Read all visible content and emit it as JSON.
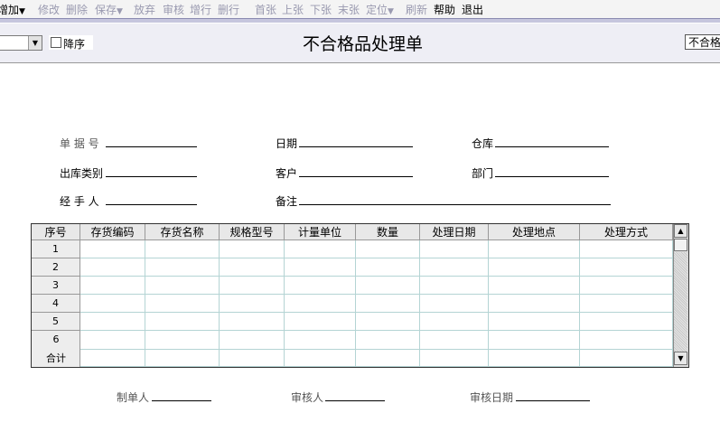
{
  "toolbar": {
    "items": [
      {
        "label": "增加",
        "enabled": true,
        "dropdown": true
      },
      {
        "label": "修改",
        "enabled": false
      },
      {
        "label": "删除",
        "enabled": false
      },
      {
        "label": "保存",
        "enabled": false,
        "dropdown": true
      },
      {
        "label": "放弃",
        "enabled": false
      },
      {
        "label": "审核",
        "enabled": false
      },
      {
        "label": "增行",
        "enabled": false
      },
      {
        "label": "删行",
        "enabled": false
      },
      {
        "label": "首张",
        "enabled": false
      },
      {
        "label": "上张",
        "enabled": false
      },
      {
        "label": "下张",
        "enabled": false
      },
      {
        "label": "末张",
        "enabled": false
      },
      {
        "label": "定位",
        "enabled": false,
        "dropdown": true
      },
      {
        "label": "刷新",
        "enabled": false
      },
      {
        "label": "帮助",
        "enabled": true
      },
      {
        "label": "退出",
        "enabled": true
      }
    ],
    "dropdown_glyph": "▼"
  },
  "header": {
    "title": "不合格品处理单",
    "sort_checkbox_label": "降序",
    "sort_checked": false,
    "combo_value": "",
    "right_box_value": "不合格品处理单"
  },
  "form": {
    "doc_no_label": "单 据 号",
    "date_label": "日期",
    "warehouse_label": "仓库",
    "out_type_label": "出库类别",
    "customer_label": "客户",
    "department_label": "部门",
    "handler_label": "经 手 人",
    "remark_label": "备注"
  },
  "grid": {
    "columns": [
      "序号",
      "存货编码",
      "存货名称",
      "规格型号",
      "计量单位",
      "数量",
      "处理日期",
      "处理地点",
      "处理方式"
    ],
    "row_labels": [
      "1",
      "2",
      "3",
      "4",
      "5",
      "6"
    ],
    "total_label": "合计"
  },
  "footer": {
    "maker_label": "制单人",
    "auditor_label": "审核人",
    "audit_date_label": "审核日期"
  },
  "colors": {
    "disabled_text": "#9a9ab0",
    "header_bg": "#eeeef5",
    "grid_line": "#b4d4d4"
  }
}
